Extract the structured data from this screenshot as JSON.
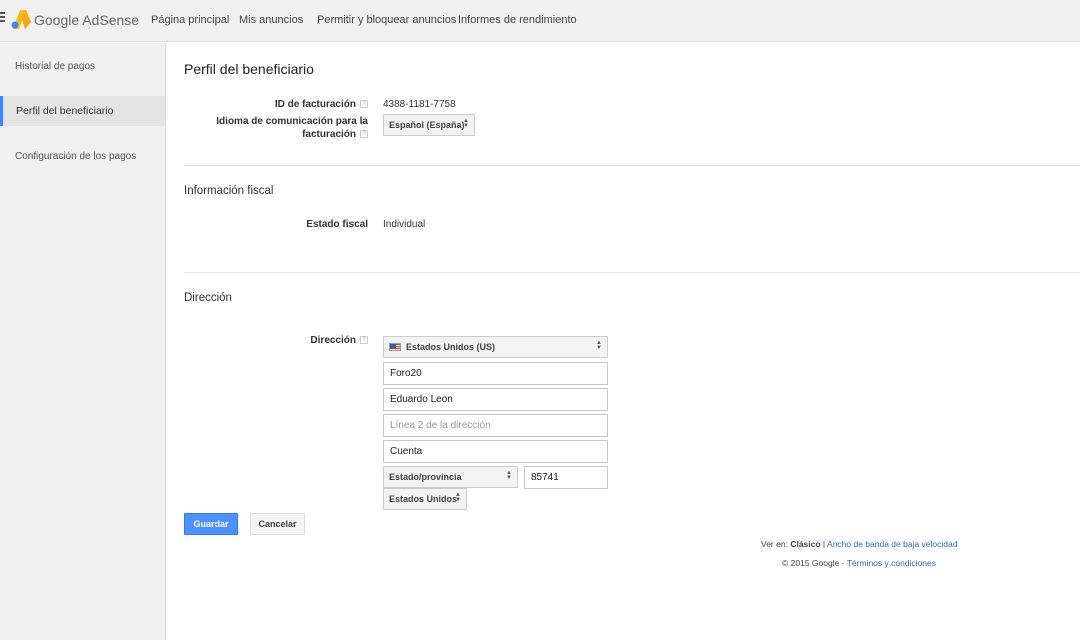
{
  "header": {
    "brand": "Google AdSense",
    "nav": [
      "Página principal",
      "Mis anuncios",
      "Permitir y bloquear anuncios",
      "Informes de rendimiento"
    ]
  },
  "sidebar": {
    "items": [
      {
        "label": "Historial de pagos",
        "active": false
      },
      {
        "label": "Perfil del beneficiario",
        "active": true
      },
      {
        "label": "Configuración de los pagos",
        "active": false
      }
    ]
  },
  "page": {
    "title": "Perfil del beneficiario",
    "billing_id_label": "ID de facturación",
    "billing_id_value": "4388-1181-7758",
    "language_label_line1": "Idioma de comunicación para la",
    "language_label_line2": "facturación",
    "language_value": "Español (España)",
    "help_icon": "?"
  },
  "tax": {
    "section_title": "Información fiscal",
    "status_label": "Estado fiscal",
    "status_value": "Individual"
  },
  "address": {
    "section_title": "Dirección",
    "label": "Dirección",
    "country": "Estados Unidos (US)",
    "line_name": "Foro20",
    "line_1": "Eduardo Leon",
    "line_2_placeholder": "Línea 2 de la dirección",
    "city": "Cuenta",
    "state_placeholder": "Estado/provincia",
    "postal_code": "85741",
    "country_short": "Estados Unidos"
  },
  "actions": {
    "save": "Guardar",
    "cancel": "Cancelar"
  },
  "footer": {
    "view_in": "Ver en: ",
    "classic": "Clásico",
    "separator": " | ",
    "low_bandwidth": "Ancho de banda de baja velocidad",
    "copyright": "© 2015 Google - ",
    "terms": "Términos y condiciones"
  },
  "colors": {
    "accent": "#4285f4",
    "primary_button": "#4d90fe",
    "link": "#3366cc"
  }
}
